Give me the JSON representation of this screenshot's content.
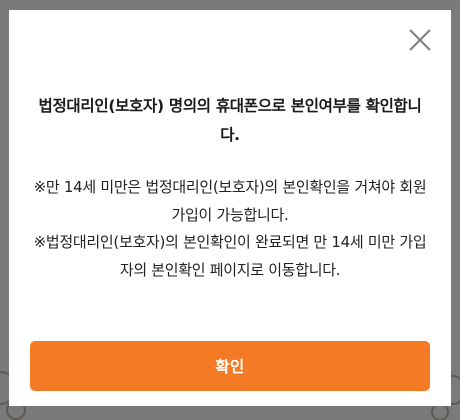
{
  "dialog": {
    "close_icon": "close-icon",
    "title": "법정대리인(보호자) 명의의 휴대폰으로 본인여부를 확인합니다.",
    "notice_lines": [
      "※만 14세 미만은 법정대리인(보호자)의 본인확인을 거쳐야 회원가입이 가능합니다.",
      "※법정대리인(보호자)의 본인확인이 완료되면 만 14세 미만 가입자의 본인확인 페이지로 이동합니다."
    ],
    "confirm_label": "확인"
  },
  "colors": {
    "accent": "#f57a25",
    "overlay": "#7a7a7a",
    "panel": "#ffffff",
    "text": "#222222"
  }
}
